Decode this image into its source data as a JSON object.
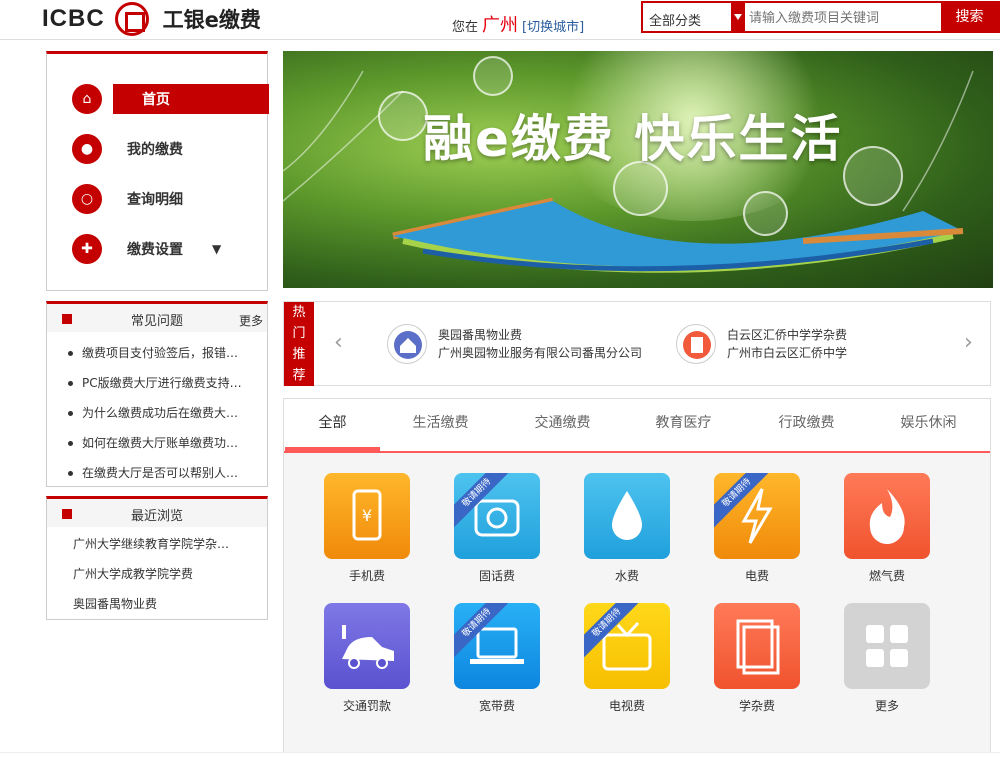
{
  "header": {
    "logo_text": "ICBC",
    "brand_name": "工银e缴费",
    "city_prefix": "您在",
    "city": "广州",
    "switch_city": "[切换城市]",
    "category_select": "全部分类",
    "search_placeholder": "请输入缴费项目关键词",
    "search_button": "搜索"
  },
  "nav": {
    "items": [
      {
        "label": "首页",
        "icon": "home-icon"
      },
      {
        "label": "我的缴费",
        "icon": "user-icon"
      },
      {
        "label": "查询明细",
        "icon": "search-icon"
      },
      {
        "label": "缴费设置",
        "icon": "settings-icon"
      }
    ],
    "caret": "▼"
  },
  "faq": {
    "title": "常见问题",
    "more": "更多",
    "items": [
      "缴费项目支付验签后，报错…",
      "PC版缴费大厅进行缴费支持…",
      "为什么缴费成功后在缴费大…",
      "如何在缴费大厅账单缴费功…",
      "在缴费大厅是否可以帮别人…"
    ]
  },
  "recent": {
    "title": "最近浏览",
    "items": [
      "广州大学继续教育学院学杂…",
      "广州大学成教学院学费",
      "奥园番禺物业费"
    ]
  },
  "banner": {
    "headline": "融e缴费  快乐生活"
  },
  "hot": {
    "tag": [
      "热",
      "门",
      "推",
      "荐"
    ],
    "prev": "‹",
    "next": "›",
    "items": [
      {
        "title": "奥园番禺物业费",
        "org": "广州奥园物业服务有限公司番禺分公司",
        "icon": "house-icon"
      },
      {
        "title": "白云区汇侨中学学杂费",
        "org": "广州市白云区汇侨中学",
        "icon": "book-icon"
      }
    ]
  },
  "categories": {
    "tabs": [
      "全部",
      "生活缴费",
      "交通缴费",
      "教育医疗",
      "行政缴费",
      "娱乐休闲"
    ],
    "ribbon": "敬请期待",
    "tiles": [
      {
        "label": "手机费",
        "icon": "phone-icon",
        "color": "#f7a21b"
      },
      {
        "label": "固话费",
        "icon": "telephone-icon",
        "color": "#2fb3e8"
      },
      {
        "label": "水费",
        "icon": "water-icon",
        "color": "#2fb3e8"
      },
      {
        "label": "电费",
        "icon": "lightning-icon",
        "color": "#f7a21b"
      },
      {
        "label": "燃气费",
        "icon": "flame-icon",
        "color": "#f56a4c"
      },
      {
        "label": "交通罚款",
        "icon": "car-icon",
        "color": "#6a63d8"
      },
      {
        "label": "宽带费",
        "icon": "laptop-icon",
        "color": "#1a9ef0"
      },
      {
        "label": "电视费",
        "icon": "tv-icon",
        "color": "#f9c800"
      },
      {
        "label": "学杂费",
        "icon": "books-icon",
        "color": "#f56a4c"
      },
      {
        "label": "更多",
        "icon": "grid-icon",
        "color": "#cfcfcf"
      }
    ]
  }
}
